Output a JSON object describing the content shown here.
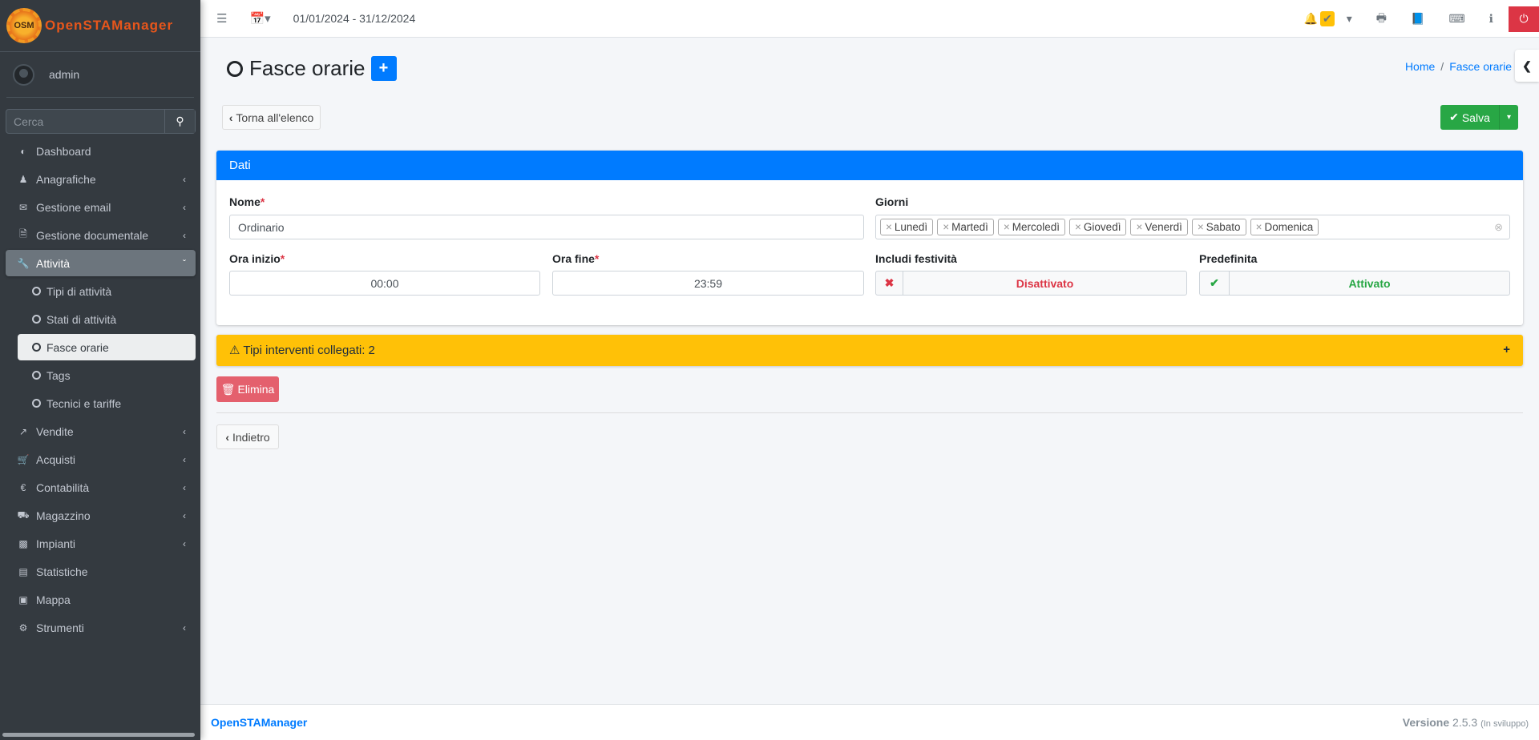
{
  "app": {
    "logo_text": "OpenSTAManager",
    "logo_badge": "OSM"
  },
  "user": {
    "name": "admin"
  },
  "search": {
    "placeholder": "Cerca"
  },
  "sidebar": {
    "items": [
      {
        "label": "Dashboard",
        "icon": "dashboard-icon"
      },
      {
        "label": "Anagrafiche",
        "icon": "users-icon"
      },
      {
        "label": "Gestione email",
        "icon": "envelope-icon"
      },
      {
        "label": "Gestione documentale",
        "icon": "file-icon"
      },
      {
        "label": "Attività",
        "icon": "wrench-icon"
      },
      {
        "label": "Tipi di attività"
      },
      {
        "label": "Stati di attività"
      },
      {
        "label": "Fasce orarie"
      },
      {
        "label": "Tags"
      },
      {
        "label": "Tecnici e tariffe"
      },
      {
        "label": "Vendite",
        "icon": "chart-line-icon"
      },
      {
        "label": "Acquisti",
        "icon": "cart-icon"
      },
      {
        "label": "Contabilità",
        "icon": "euro-icon"
      },
      {
        "label": "Magazzino",
        "icon": "truck-icon"
      },
      {
        "label": "Impianti",
        "icon": "puzzle-icon"
      },
      {
        "label": "Statistiche",
        "icon": "bar-chart-icon"
      },
      {
        "label": "Mappa",
        "icon": "map-icon"
      },
      {
        "label": "Strumenti",
        "icon": "cog-icon"
      }
    ]
  },
  "topbar": {
    "period": "01/01/2024 - 31/12/2024"
  },
  "page": {
    "title": "Fasce orarie",
    "breadcrumb": [
      "Home",
      "Fasce orarie"
    ],
    "back_label": "Torna all'elenco",
    "save_label": "Salva"
  },
  "form": {
    "header": "Dati",
    "nome": {
      "label": "Nome",
      "value": "Ordinario"
    },
    "giorni": {
      "label": "Giorni",
      "values": [
        "Lunedì",
        "Martedì",
        "Mercoledì",
        "Giovedì",
        "Venerdì",
        "Sabato",
        "Domenica"
      ]
    },
    "ora_inizio": {
      "label": "Ora inizio",
      "value": "00:00"
    },
    "ora_fine": {
      "label": "Ora fine",
      "value": "23:59"
    },
    "festivita": {
      "label": "Includi festività",
      "value": "Disattivato",
      "color": "#dc3545"
    },
    "predefinita": {
      "label": "Predefinita",
      "value": "Attivato",
      "color": "#28a745"
    },
    "required_mark": "*"
  },
  "warning": {
    "text": "Tipi interventi collegati: 2"
  },
  "actions": {
    "delete_label": "Elimina",
    "back_label": "Indietro"
  },
  "footer": {
    "brand": "OpenSTAManager",
    "version_label": "Versione",
    "version": "2.5.3",
    "dev": "(In sviluppo)"
  }
}
